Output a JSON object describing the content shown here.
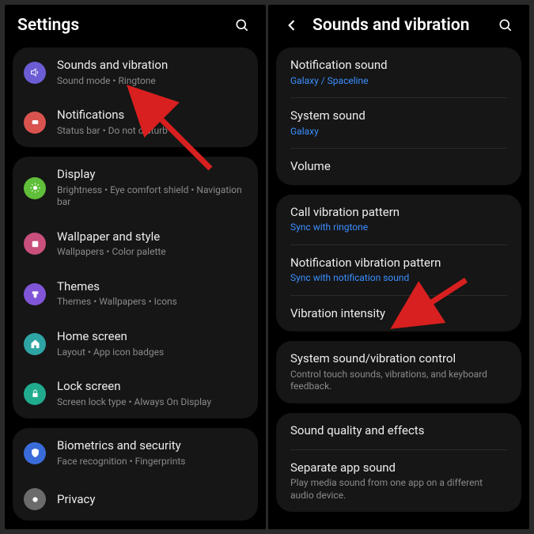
{
  "left": {
    "title": "Settings",
    "groups": [
      [
        {
          "title": "Sounds and vibration",
          "sub": "Sound mode  •  Ringtone",
          "icon": "speaker-icon",
          "color": "c-purple"
        },
        {
          "title": "Notifications",
          "sub": "Status bar  •  Do not disturb",
          "icon": "bell-icon",
          "color": "c-red"
        }
      ],
      [
        {
          "title": "Display",
          "sub": "Brightness  •  Eye comfort shield  •  Navigation bar",
          "icon": "sun-icon",
          "color": "c-green"
        },
        {
          "title": "Wallpaper and style",
          "sub": "Wallpapers  •  Color palette",
          "icon": "picture-icon",
          "color": "c-pink"
        },
        {
          "title": "Themes",
          "sub": "Themes  •  Wallpapers  •  Icons",
          "icon": "brush-icon",
          "color": "c-violet"
        },
        {
          "title": "Home screen",
          "sub": "Layout  •  App icon badges",
          "icon": "home-icon",
          "color": "c-teal"
        },
        {
          "title": "Lock screen",
          "sub": "Screen lock type  •  Always On Display",
          "icon": "lock-icon",
          "color": "c-teal2"
        }
      ],
      [
        {
          "title": "Biometrics and security",
          "sub": "Face recognition  •  Fingerprints",
          "icon": "shield-icon",
          "color": "c-blue"
        },
        {
          "title": "Privacy",
          "sub": "",
          "icon": "privacy-icon",
          "color": "c-gray"
        }
      ]
    ]
  },
  "right": {
    "title": "Sounds and vibration",
    "groups": [
      [
        {
          "title": "Notification sound",
          "sub": "Galaxy / Spaceline",
          "blue": true
        },
        {
          "title": "System sound",
          "sub": "Galaxy",
          "blue": true
        },
        {
          "title": "Volume",
          "sub": ""
        }
      ],
      [
        {
          "title": "Call vibration pattern",
          "sub": "Sync with ringtone",
          "blue": true
        },
        {
          "title": "Notification vibration pattern",
          "sub": "Sync with notification sound",
          "blue": true
        },
        {
          "title": "Vibration intensity",
          "sub": ""
        }
      ],
      [
        {
          "title": "System sound/vibration control",
          "sub": "Control touch sounds, vibrations, and keyboard feedback."
        }
      ],
      [
        {
          "title": "Sound quality and effects",
          "sub": ""
        },
        {
          "title": "Separate app sound",
          "sub": "Play media sound from one app on a different audio device."
        }
      ]
    ]
  }
}
